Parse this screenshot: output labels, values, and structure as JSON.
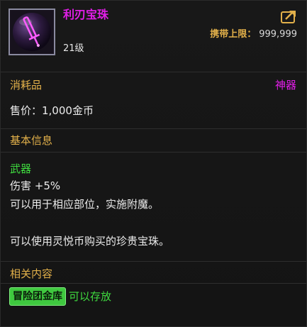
{
  "item": {
    "name": "利刃宝珠",
    "level": "21级",
    "carry_limit_label": "携带上限：",
    "carry_limit_value": "999,999",
    "type": "消耗品",
    "rarity": "神器",
    "price": "售价：1,000金币"
  },
  "basic_info": {
    "title": "基本信息",
    "category": "武器",
    "effect": "伤害 +5%",
    "usage": "可以用于相应部位，实施附魔。",
    "description": "可以使用灵悦币购买的珍贵宝珠。"
  },
  "related": {
    "title": "相关内容",
    "storage_badge": "冒险团金库",
    "storage_status": "可以存放"
  },
  "colors": {
    "name_purple": "#e11ee8",
    "label_gold": "#e2b04a",
    "green": "#3fdc3f",
    "text": "#ececec"
  },
  "icons": {
    "item": "sword-orb-icon",
    "share": "share-arrow-icon"
  }
}
